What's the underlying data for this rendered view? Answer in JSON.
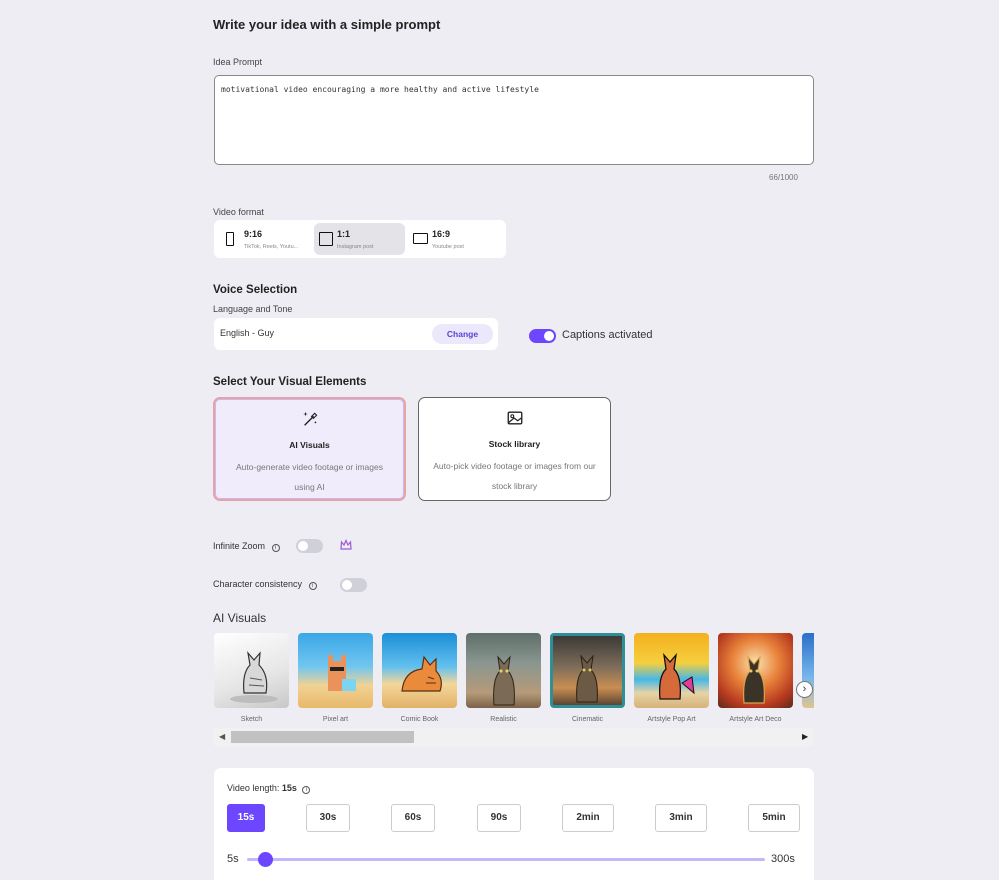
{
  "header": {
    "title": "Write your idea with a simple prompt"
  },
  "prompt": {
    "label": "Idea Prompt",
    "value": "motivational video encouraging a more healthy and active lifestyle",
    "counter": "66/1000"
  },
  "video_format": {
    "label": "Video format",
    "options": [
      {
        "title": "9:16",
        "sub": "TikTok, Reels, Youtu...",
        "selected": false
      },
      {
        "title": "1:1",
        "sub": "Instagram post",
        "selected": true
      },
      {
        "title": "16:9",
        "sub": "Youtube post",
        "selected": false
      }
    ]
  },
  "voice": {
    "title": "Voice Selection",
    "label": "Language and Tone",
    "value": "English - Guy",
    "change_label": "Change",
    "captions_label": "Captions activated",
    "captions_on": true
  },
  "visual_elements": {
    "title": "Select Your Visual Elements",
    "cards": [
      {
        "title": "AI Visuals",
        "desc": "Auto-generate video footage or images using AI",
        "icon": "magic-wand-icon",
        "selected": true
      },
      {
        "title": "Stock library",
        "desc": "Auto-pick video footage or images from our stock library",
        "icon": "image-icon",
        "selected": false
      }
    ]
  },
  "options": {
    "infinite_zoom": "Infinite Zoom",
    "character_consistency": "Character consistency"
  },
  "ai_visuals": {
    "title": "AI Visuals",
    "styles": [
      "Sketch",
      "Pixel art",
      "Comic Book",
      "Realistic",
      "Cinematic",
      "Artstyle Pop Art",
      "Artstyle Art Deco"
    ],
    "selected": "Cinematic"
  },
  "video_length": {
    "label": "Video length:",
    "value": "15s",
    "options": [
      "15s",
      "30s",
      "60s",
      "90s",
      "2min",
      "3min",
      "5min"
    ],
    "selected": "15s",
    "slider_min": "5s",
    "slider_max": "300s"
  },
  "colors": {
    "accent": "#6c47ff"
  }
}
